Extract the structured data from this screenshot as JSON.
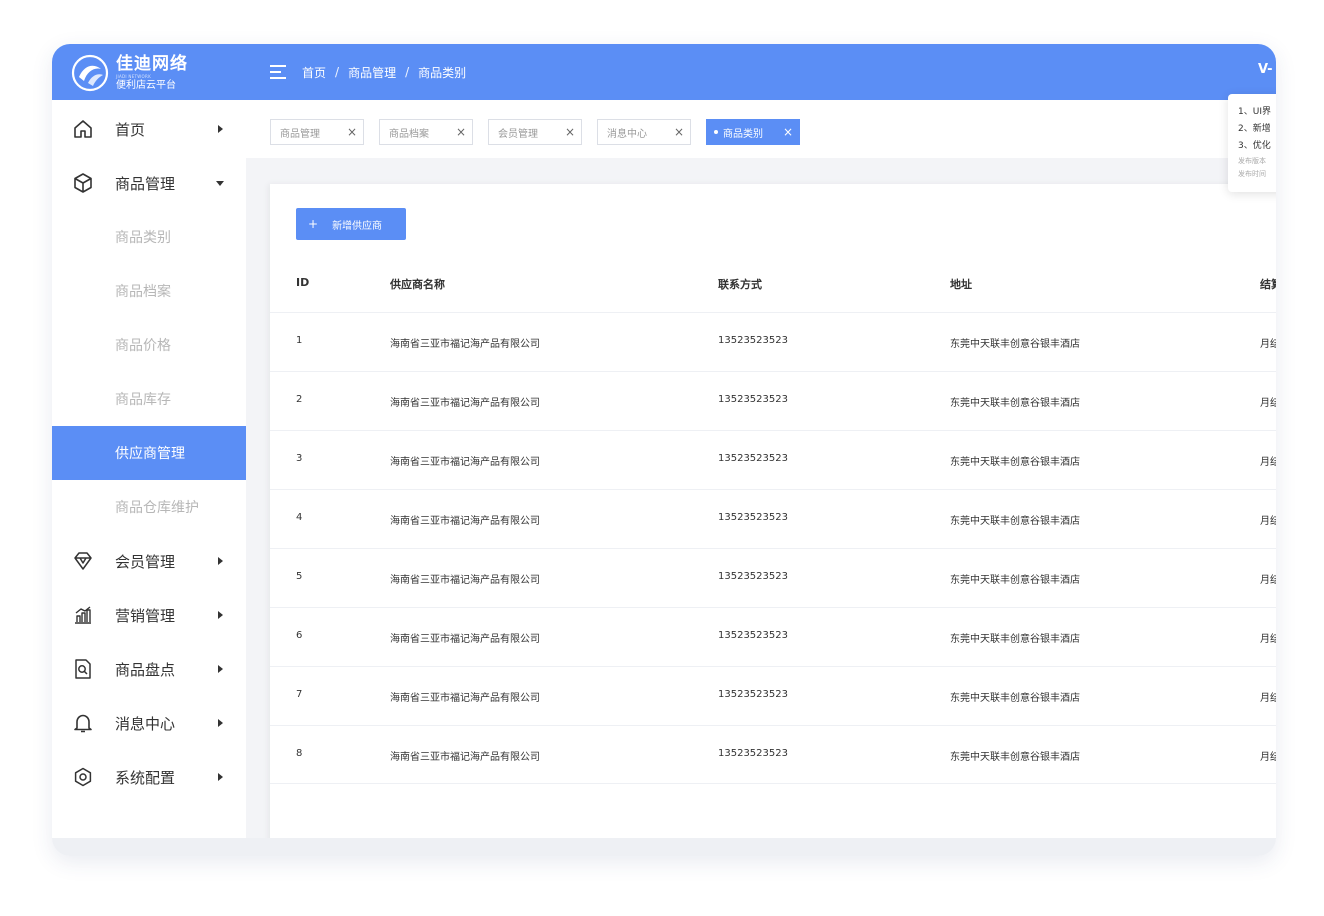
{
  "header": {
    "logo_name": "佳迪网络",
    "logo_en": "JIADI NETWORK",
    "logo_sub": "便利店云平台",
    "breadcrumb": [
      "首页",
      "商品管理",
      "商品类别"
    ],
    "breadcrumb_sep": "/",
    "version": "V-"
  },
  "sidebar": {
    "items": [
      {
        "label": "首页",
        "icon": "home-icon"
      },
      {
        "label": "商品管理",
        "icon": "box-icon"
      },
      {
        "label": "会员管理",
        "icon": "diamond-icon"
      },
      {
        "label": "营销管理",
        "icon": "chart-icon"
      },
      {
        "label": "商品盘点",
        "icon": "search-doc-icon"
      },
      {
        "label": "消息中心",
        "icon": "bell-icon"
      },
      {
        "label": "系统配置",
        "icon": "settings-icon"
      }
    ],
    "sub_items": [
      "商品类别",
      "商品档案",
      "商品价格",
      "商品库存",
      "供应商管理",
      "商品仓库维护"
    ],
    "active_sub": "供应商管理"
  },
  "tabs": [
    {
      "label": "商品管理"
    },
    {
      "label": "商品档案"
    },
    {
      "label": "会员管理"
    },
    {
      "label": "消息中心"
    },
    {
      "label": "商品类别",
      "active": true
    }
  ],
  "tab_close": "×",
  "popover": {
    "lines": [
      "1、UI界",
      "2、新增",
      "3、优化"
    ],
    "meta": [
      "发布版本",
      "发布时间"
    ]
  },
  "main": {
    "add_button": "新增供应商",
    "add_icon": "+",
    "columns": [
      "ID",
      "供应商名称",
      "联系方式",
      "地址",
      "结算"
    ],
    "rows": [
      [
        "1",
        "海南省三亚市福记海产品有限公司",
        "13523523523",
        "东莞中天联丰创意谷银丰酒店",
        "月结"
      ],
      [
        "2",
        "海南省三亚市福记海产品有限公司",
        "13523523523",
        "东莞中天联丰创意谷银丰酒店",
        "月结"
      ],
      [
        "3",
        "海南省三亚市福记海产品有限公司",
        "13523523523",
        "东莞中天联丰创意谷银丰酒店",
        "月结"
      ],
      [
        "4",
        "海南省三亚市福记海产品有限公司",
        "13523523523",
        "东莞中天联丰创意谷银丰酒店",
        "月结"
      ],
      [
        "5",
        "海南省三亚市福记海产品有限公司",
        "13523523523",
        "东莞中天联丰创意谷银丰酒店",
        "月结"
      ],
      [
        "6",
        "海南省三亚市福记海产品有限公司",
        "13523523523",
        "东莞中天联丰创意谷银丰酒店",
        "月结"
      ],
      [
        "7",
        "海南省三亚市福记海产品有限公司",
        "13523523523",
        "东莞中天联丰创意谷银丰酒店",
        "月结"
      ],
      [
        "8",
        "海南省三亚市福记海产品有限公司",
        "13523523523",
        "东莞中天联丰创意谷银丰酒店",
        "月结"
      ]
    ]
  },
  "colors": {
    "primary": "#5b8ef5",
    "sub_text": "#b7b7b7",
    "text": "#333333",
    "bg": "#f3f4f7"
  }
}
